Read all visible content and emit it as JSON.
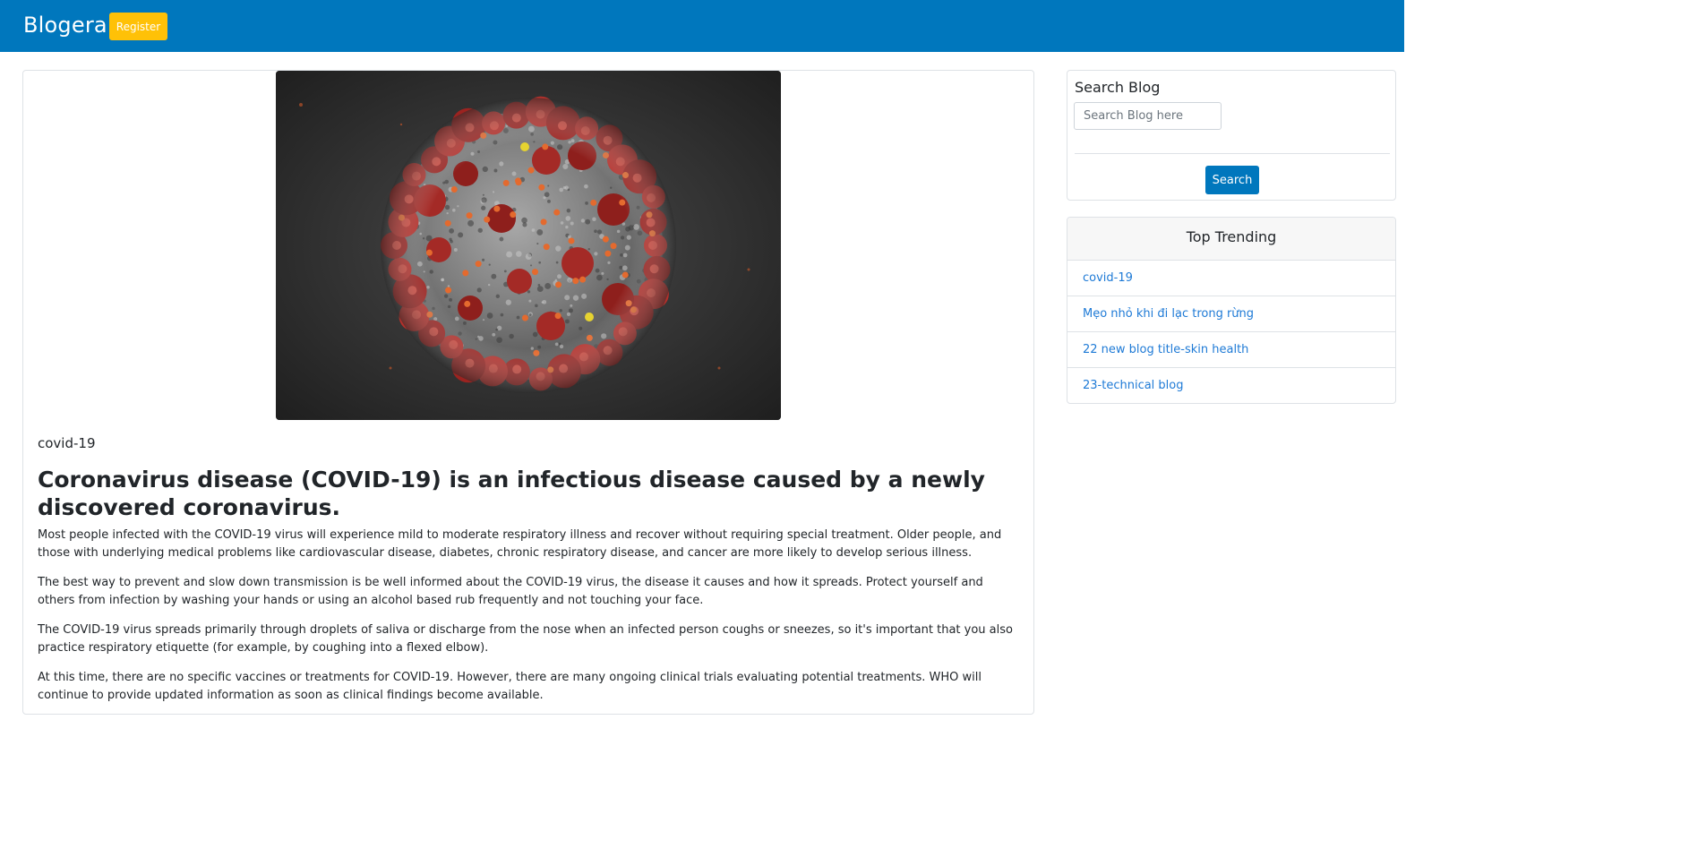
{
  "header": {
    "brand": "Blogera",
    "register_label": "Register",
    "background_color": "#0077bd",
    "register_color": "#ffc107"
  },
  "post": {
    "image_icon": "coronavirus-image",
    "tag": "covid-19",
    "headline": "Coronavirus disease (COVID-19) is an infectious disease caused by a newly discovered coronavirus.",
    "paragraphs": [
      "Most people infected with the COVID-19 virus will experience mild to moderate respiratory illness and recover without requiring special treatment.  Older people, and those with underlying medical problems like cardiovascular disease, diabetes, chronic respiratory disease, and cancer are more likely to develop serious illness.",
      "The best way to prevent and slow down transmission is be well informed about the COVID-19 virus, the disease it causes and how it spreads. Protect yourself and others from infection by washing your hands or using an alcohol based rub frequently and not touching your face.",
      "The COVID-19 virus spreads primarily through droplets of saliva or discharge from the nose when an infected person coughs or sneezes, so it's important that you also practice respiratory etiquette (for example, by coughing into a flexed elbow).",
      "At this time, there are no specific vaccines or treatments for COVID-19. However, there are many ongoing clinical trials evaluating potential treatments. WHO will continue to provide updated information as soon as clinical findings become available."
    ]
  },
  "sidebar": {
    "search": {
      "title": "Search Blog",
      "placeholder": "Search Blog here",
      "value": "",
      "button_label": "Search",
      "button_color": "#0077bd"
    },
    "trending": {
      "title": "Top Trending",
      "link_color": "#1e7ad6",
      "items": [
        {
          "label": "covid-19"
        },
        {
          "label": "Mẹo nhỏ khi đi lạc trong rừng"
        },
        {
          "label": "22 new blog title-skin health"
        },
        {
          "label": "23-technical blog"
        }
      ]
    }
  }
}
